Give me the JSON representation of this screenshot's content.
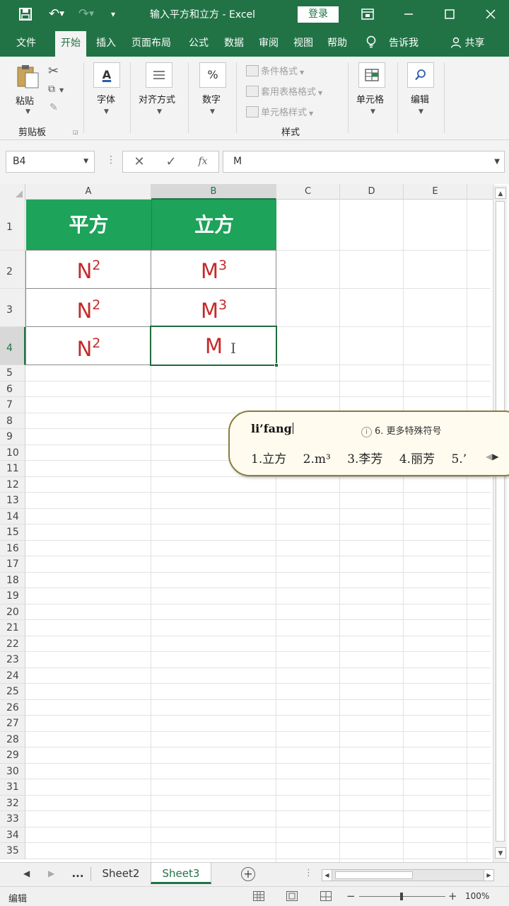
{
  "app": {
    "title": "输入平方和立方 - Excel",
    "login_label": "登录",
    "share_label": "共享",
    "tell_me_label": "告诉我"
  },
  "tabs": [
    "文件",
    "开始",
    "插入",
    "页面布局",
    "公式",
    "数据",
    "审阅",
    "视图",
    "帮助"
  ],
  "active_tab_index": 1,
  "ribbon": {
    "paste_label": "粘贴",
    "clipboard_group": "剪贴板",
    "font_label": "字体",
    "align_label": "对齐方式",
    "number_label": "数字",
    "conditional_format": "条件格式",
    "table_format": "套用表格格式",
    "cell_style": "单元格样式",
    "styles_group": "样式",
    "cells_label": "单元格",
    "edit_label": "编辑"
  },
  "formula_bar": {
    "name_box": "B4",
    "cancel_symbol": "✕",
    "enter_symbol": "✓",
    "function_symbol": "fx",
    "value": "M"
  },
  "columns": [
    "A",
    "B",
    "C",
    "D",
    "E"
  ],
  "rows": [
    "1",
    "2",
    "3",
    "4",
    "5",
    "6",
    "7",
    "8",
    "9",
    "10",
    "11",
    "12",
    "13",
    "14",
    "15",
    "16",
    "17",
    "18",
    "19",
    "20",
    "21",
    "22",
    "23",
    "24",
    "25",
    "26",
    "27",
    "28",
    "29",
    "30",
    "31",
    "32",
    "33",
    "34",
    "35"
  ],
  "selected_cell": "B4",
  "table": {
    "headers": [
      "平方",
      "立方"
    ],
    "rows": [
      [
        {
          "base": "N",
          "exp": "2"
        },
        {
          "base": "M",
          "exp": "3"
        }
      ],
      [
        {
          "base": "N",
          "exp": "2"
        },
        {
          "base": "M",
          "exp": "3"
        }
      ],
      [
        {
          "base": "N",
          "exp": "2"
        },
        {
          "base": "M",
          "exp": ""
        }
      ]
    ]
  },
  "ime": {
    "input": "li’fang",
    "special_symbols": "6. 更多特殊符号",
    "candidates": [
      "1.立方",
      "2.m³",
      "3.李芳",
      "4.丽芳",
      "5.’"
    ]
  },
  "sheets": {
    "more_label": "...",
    "names": [
      "Sheet2",
      "Sheet3"
    ],
    "active": "Sheet3"
  },
  "status": {
    "mode": "编辑",
    "zoom_minus": "−",
    "zoom_plus": "+",
    "zoom_level": "100%"
  },
  "colors": {
    "excel_green": "#217346",
    "header_fill": "#1da35a",
    "value_red": "#c62828"
  }
}
